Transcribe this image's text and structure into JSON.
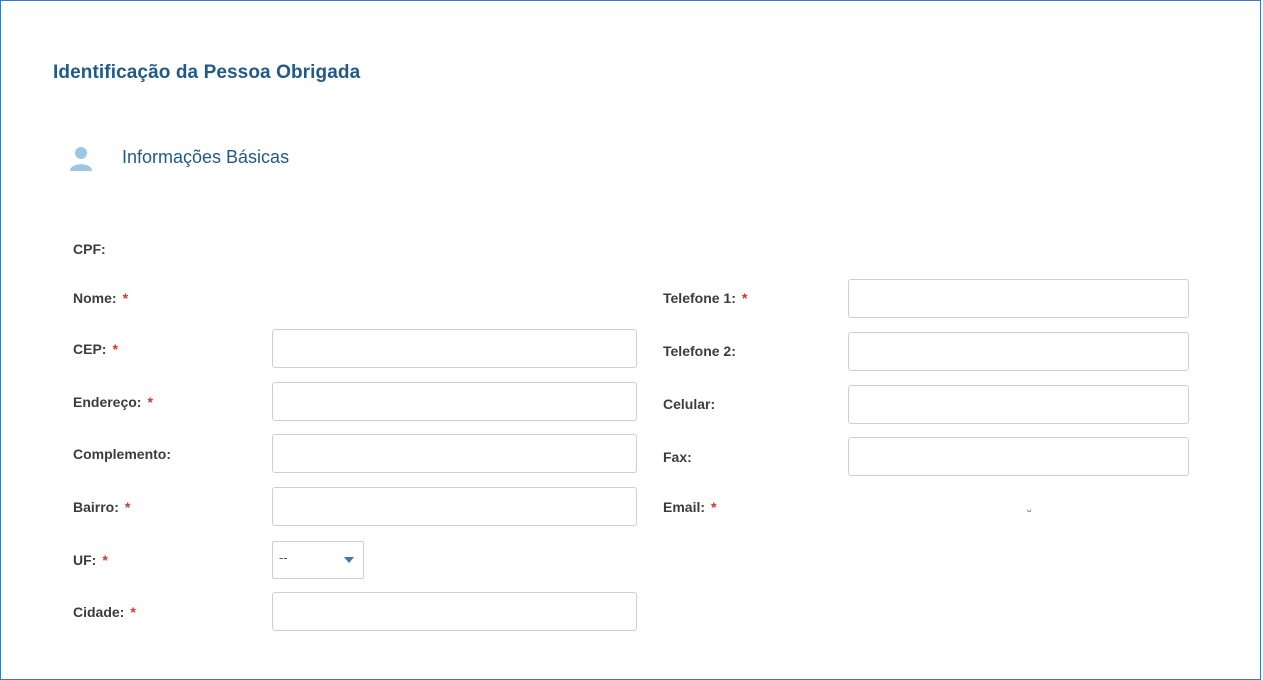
{
  "page": {
    "title": "Identificação da Pessoa Obrigada"
  },
  "section": {
    "title": "Informações Básicas",
    "icon": "user-icon"
  },
  "required_marker": "*",
  "colors": {
    "title": "#1f5a8a",
    "required": "#d9342b",
    "icon": "#9cc5e6",
    "frame_border": "#3a78c9"
  },
  "form": {
    "cpf": {
      "label": "CPF:"
    },
    "nome": {
      "label": "Nome:"
    },
    "cep": {
      "label": "CEP:",
      "value": ""
    },
    "endereco": {
      "label": "Endereço:",
      "value": ""
    },
    "complemento": {
      "label": "Complemento:",
      "value": ""
    },
    "bairro": {
      "label": "Bairro:",
      "value": ""
    },
    "uf": {
      "label": "UF:",
      "selected": "--",
      "icon": "caret-down-icon"
    },
    "cidade": {
      "label": "Cidade:",
      "value": ""
    },
    "telefone1": {
      "label": "Telefone 1:",
      "value": ""
    },
    "telefone2": {
      "label": "Telefone 2:",
      "value": ""
    },
    "celular": {
      "label": "Celular:",
      "value": ""
    },
    "fax": {
      "label": "Fax:",
      "value": ""
    },
    "email": {
      "label": "Email:",
      "value": "ᵕ"
    }
  }
}
